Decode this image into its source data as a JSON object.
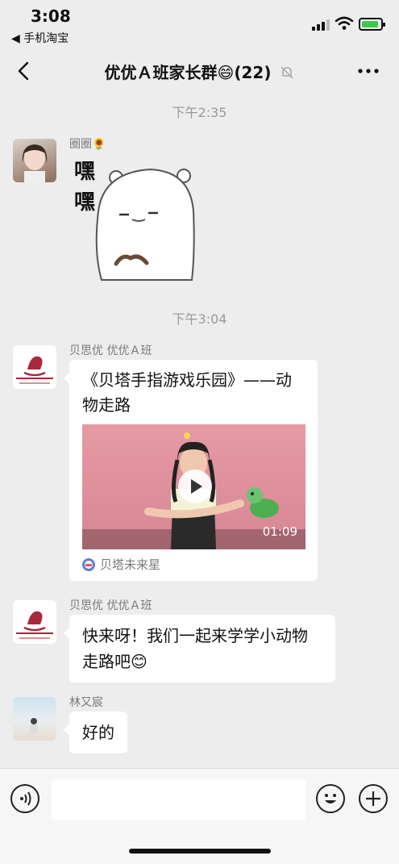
{
  "status_bar": {
    "time": "3:08",
    "back_app": "◀ 手机淘宝",
    "battery_color": "#3ec74b"
  },
  "nav": {
    "title": "优优Ａ班家长群😄(22)",
    "back_icon": "chevron-left-icon",
    "mute_icon": "bell-off-icon",
    "more_icon": "ellipsis-icon"
  },
  "messages": {
    "ts1": "下午2:35",
    "m1": {
      "sender": "圈圈🌻",
      "sticker_text": "嘿嘿"
    },
    "ts2": "下午3:04",
    "m2": {
      "sender": "贝思优 优优Ａ班",
      "card_title": "《贝塔手指游戏乐园》——动物走路",
      "duration": "01:09",
      "source": "贝塔未来星",
      "logo_text": "贝思优 | BEST U"
    },
    "m3": {
      "sender": "贝思优 优优Ａ班",
      "text": "快来呀！我们一起来学学小动物走路吧😊"
    },
    "m4": {
      "sender": "林又宸",
      "text": "好的"
    }
  },
  "input_bar": {
    "placeholder": "",
    "voice_icon": "voice-icon",
    "emoji_icon": "emoji-icon",
    "plus_icon": "plus-icon"
  }
}
